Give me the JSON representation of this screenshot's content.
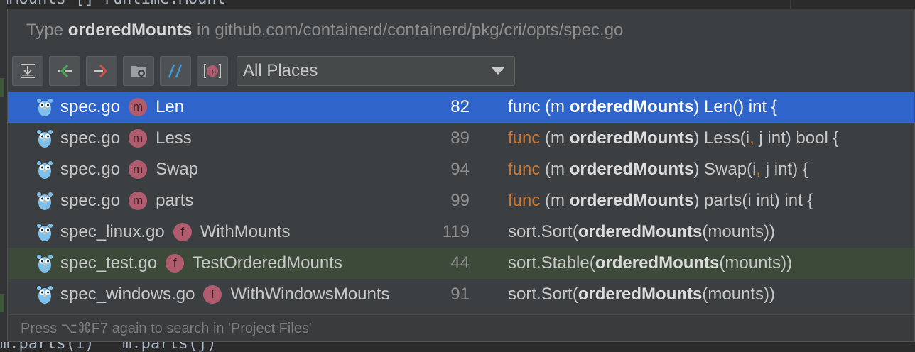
{
  "editor": {
    "top_code": "dMounts []*runtime.Mount",
    "bottom_code": "m.parts(i)   m.parts(j)"
  },
  "header": {
    "prefix": "Type ",
    "type_name": "orderedMounts",
    "suffix": " in github.com/containerd/containerd/pkg/cri/opts/spec.go"
  },
  "toolbar": {
    "buttons": [
      {
        "icon": "expand-all-icon"
      },
      {
        "icon": "previous-occurrence-icon"
      },
      {
        "icon": "next-occurrence-icon"
      },
      {
        "icon": "group-by-directory-icon"
      },
      {
        "icon": "filter-comments-icon"
      },
      {
        "icon": "show-members-icon",
        "label": "m"
      }
    ],
    "scope": "All Places"
  },
  "results": [
    {
      "file": "spec.go",
      "kind": "m",
      "member": "Len",
      "line": "82",
      "code": [
        [
          "kw",
          "func"
        ],
        [
          "t",
          " (m "
        ],
        [
          "b",
          "orderedMounts"
        ],
        [
          "t",
          ") Len() int {"
        ]
      ],
      "selected": true
    },
    {
      "file": "spec.go",
      "kind": "m",
      "member": "Less",
      "line": "89",
      "code": [
        [
          "kw",
          "func"
        ],
        [
          "t",
          " (m "
        ],
        [
          "b",
          "orderedMounts"
        ],
        [
          "t",
          ") Less(i"
        ],
        [
          "kw",
          ","
        ],
        [
          "t",
          " j int) bool {"
        ]
      ]
    },
    {
      "file": "spec.go",
      "kind": "m",
      "member": "Swap",
      "line": "94",
      "code": [
        [
          "kw",
          "func"
        ],
        [
          "t",
          " (m "
        ],
        [
          "b",
          "orderedMounts"
        ],
        [
          "t",
          ") Swap(i"
        ],
        [
          "kw",
          ","
        ],
        [
          "t",
          " j int) {"
        ]
      ]
    },
    {
      "file": "spec.go",
      "kind": "m",
      "member": "parts",
      "line": "99",
      "code": [
        [
          "kw",
          "func"
        ],
        [
          "t",
          " (m "
        ],
        [
          "b",
          "orderedMounts"
        ],
        [
          "t",
          ") parts(i int) int {"
        ]
      ]
    },
    {
      "file": "spec_linux.go",
      "kind": "f",
      "member": "WithMounts",
      "line": "119",
      "code": [
        [
          "t",
          "sort.Sort("
        ],
        [
          "b",
          "orderedMounts"
        ],
        [
          "t",
          "(mounts))"
        ]
      ]
    },
    {
      "file": "spec_test.go",
      "kind": "f",
      "member": "TestOrderedMounts",
      "line": "44",
      "code": [
        [
          "t",
          "sort.Stable("
        ],
        [
          "b",
          "orderedMounts"
        ],
        [
          "t",
          "(mounts))"
        ]
      ],
      "test": true
    },
    {
      "file": "spec_windows.go",
      "kind": "f",
      "member": "WithWindowsMounts",
      "line": "91",
      "code": [
        [
          "t",
          "sort.Sort("
        ],
        [
          "b",
          "orderedMounts"
        ],
        [
          "t",
          "(mounts))"
        ]
      ]
    }
  ],
  "footer": {
    "hint": "Press ⌥⌘F7 again to search in 'Project Files'"
  },
  "colors": {
    "selection": "#2f65ca",
    "keyword": "#cc7832",
    "member_badge": "#b05c6e",
    "gopher": "#7fc0ea"
  }
}
